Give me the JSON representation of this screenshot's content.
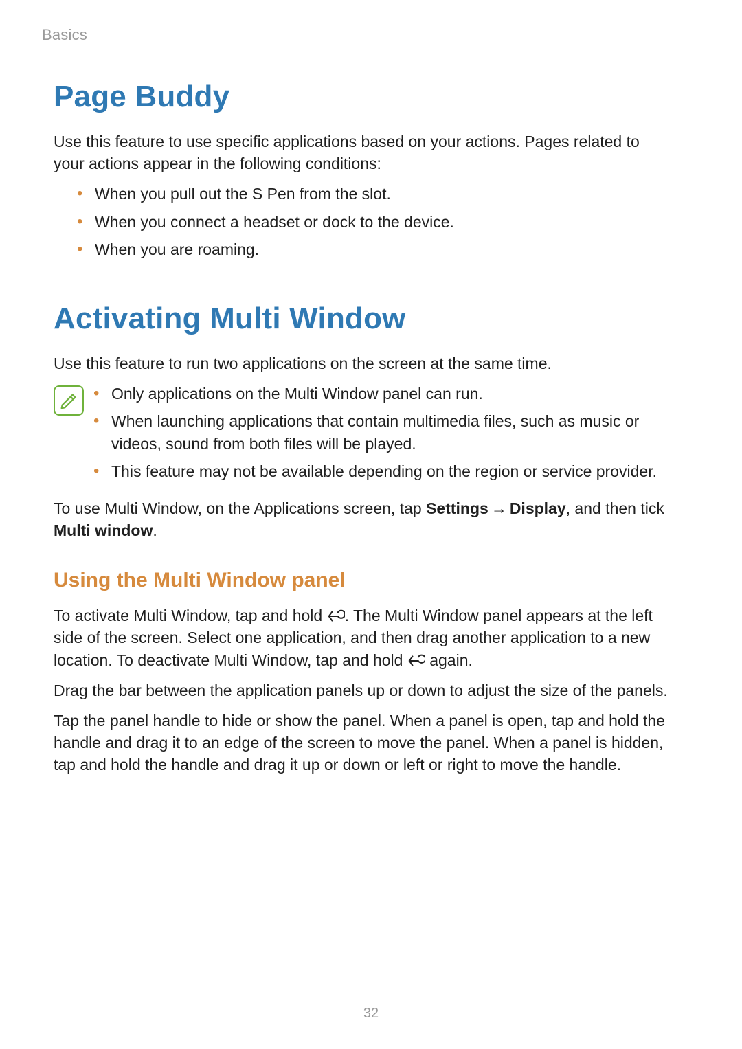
{
  "header": {
    "section": "Basics"
  },
  "pageBuddy": {
    "title": "Page Buddy",
    "intro": "Use this feature to use specific applications based on your actions. Pages related to your actions appear in the following conditions:",
    "bullets": [
      "When you pull out the S Pen from the slot.",
      "When you connect a headset or dock to the device.",
      "When you are roaming."
    ]
  },
  "multiWindow": {
    "title": "Activating Multi Window",
    "intro": "Use this feature to run two applications on the screen at the same time.",
    "notes": [
      "Only applications on the Multi Window panel can run.",
      "When launching applications that contain multimedia files, such as music or videos, sound from both files will be played.",
      "This feature may not be available depending on the region or service provider."
    ],
    "enable": {
      "pre": "To use Multi Window, on the Applications screen, tap ",
      "settings": "Settings",
      "arrow": "→",
      "display": "Display",
      "mid": ", and then tick ",
      "multiwindow": "Multi window",
      "post": "."
    },
    "panel": {
      "heading": "Using the Multi Window panel",
      "p1a": "To activate Multi Window, tap and hold ",
      "p1b": ". The Multi Window panel appears at the left side of the screen. Select one application, and then drag another application to a new location. To deactivate Multi Window, tap and hold ",
      "p1c": " again.",
      "p2": "Drag the bar between the application panels up or down to adjust the size of the panels.",
      "p3": "Tap the panel handle to hide or show the panel. When a panel is open, tap and hold the handle and drag it to an edge of the screen to move the panel. When a panel is hidden, tap and hold the handle and drag it up or down or left or right to move the handle."
    }
  },
  "pageNumber": "32"
}
